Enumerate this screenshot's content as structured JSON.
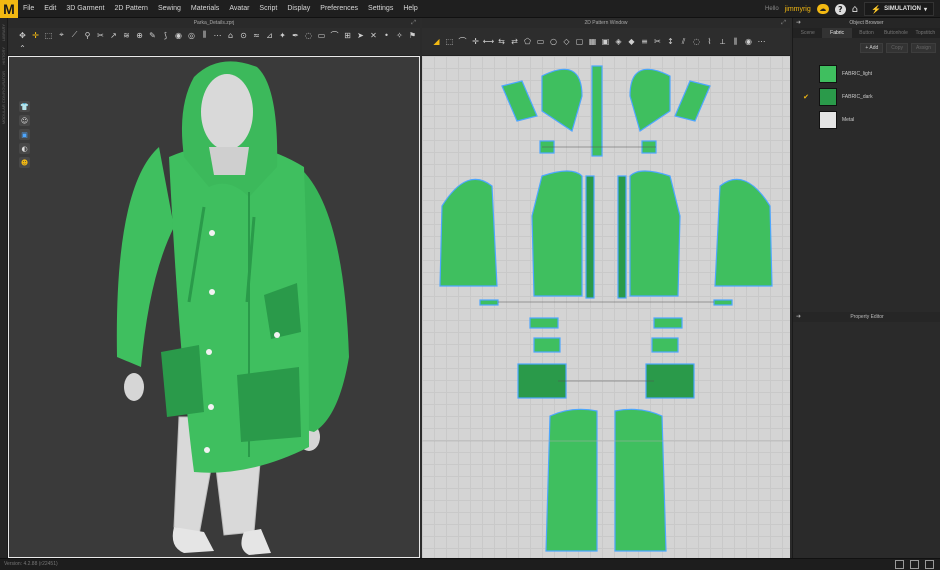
{
  "app": {
    "logo": "M"
  },
  "menu": [
    "File",
    "Edit",
    "3D Garment",
    "2D Pattern",
    "Sewing",
    "Materials",
    "Avatar",
    "Script",
    "Display",
    "Preferences",
    "Settings",
    "Help"
  ],
  "user": {
    "label": "Hello",
    "name": "jimmyrig"
  },
  "simulation": {
    "label": "SIMULATION"
  },
  "left_strip": [
    "LIBRARY",
    "HISTORY",
    "MODULAR CONFIGURATOR"
  ],
  "window3d": {
    "title": "Parka_Details.zprj"
  },
  "window2d": {
    "title": "2D Pattern Window"
  },
  "object_browser": {
    "title": "Object Browser",
    "tabs": [
      "Scene",
      "Fabric",
      "Button",
      "Buttonhole",
      "Topstitch"
    ],
    "active_tab": "Fabric",
    "actions": [
      "+ Add",
      "Copy",
      "Assign"
    ],
    "fabrics": [
      {
        "name": "FABRIC_light",
        "color": "#3fbf5f",
        "checked": false
      },
      {
        "name": "FABRIC_dark",
        "color": "#2a9a4a",
        "checked": true
      },
      {
        "name": "Metal",
        "color": "#e4e4e4",
        "checked": false
      }
    ]
  },
  "property_editor": {
    "title": "Property Editor"
  },
  "status": {
    "version": "Version: 4.2.88 (r22451)"
  },
  "icons": {
    "check": "check-icon",
    "max": "maximize-icon"
  },
  "colors": {
    "accent": "#f3b912",
    "garment": "#3fbf5f",
    "garment_dark": "#2a9a4a",
    "pattern_outline": "#4da6ff"
  }
}
